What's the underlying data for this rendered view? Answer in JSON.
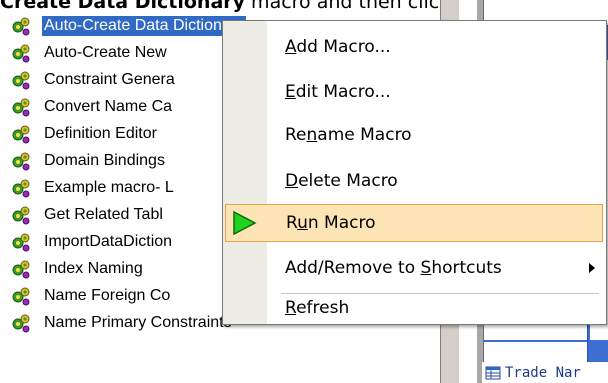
{
  "caption": {
    "bold": "Create Data Dictionary",
    "rest": " macro and then click"
  },
  "macros": [
    "Auto-Create Data Dictionary",
    "Auto-Create New",
    "Constraint Genera",
    "Convert Name Ca",
    "Definition Editor",
    "Domain Bindings",
    "Example macro- L",
    "Get Related Tabl",
    "ImportDataDiction",
    "Index Naming",
    "Name Foreign Co",
    "Name Primary Constraints"
  ],
  "selected_index": 0,
  "menu": {
    "items": [
      {
        "pre": "",
        "key": "A",
        "post": "dd Macro..."
      },
      {
        "pre": "",
        "key": "E",
        "post": "dit Macro..."
      },
      {
        "pre": "Re",
        "key": "n",
        "post": "ame Macro"
      },
      {
        "pre": "",
        "key": "D",
        "post": "elete Macro"
      },
      {
        "pre": "R",
        "key": "u",
        "post": "n Macro"
      },
      {
        "pre": "Add/Remove to ",
        "key": "S",
        "post": "hortcuts"
      },
      {
        "pre": "",
        "key": "R",
        "post": "efresh"
      }
    ],
    "highlighted_index": 4
  },
  "right_panel": {
    "trade_label": "Trade Nar"
  },
  "colors": {
    "selection": "#316ac5",
    "highlight": "#fde4b5",
    "run_arrow": "#1fd31f"
  },
  "icons": {
    "macro": "macro-gears-icon",
    "run": "run-arrow-icon",
    "table": "table-icon"
  }
}
